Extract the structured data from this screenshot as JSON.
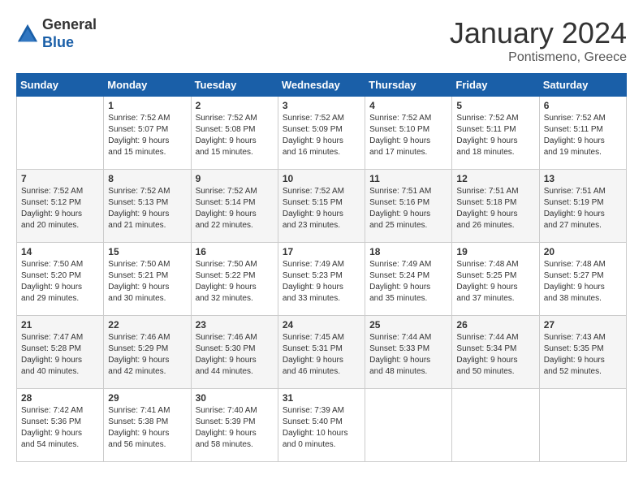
{
  "header": {
    "logo_general": "General",
    "logo_blue": "Blue",
    "month": "January 2024",
    "location": "Pontismeno, Greece"
  },
  "days_of_week": [
    "Sunday",
    "Monday",
    "Tuesday",
    "Wednesday",
    "Thursday",
    "Friday",
    "Saturday"
  ],
  "weeks": [
    [
      {
        "day": "",
        "info": ""
      },
      {
        "day": "1",
        "info": "Sunrise: 7:52 AM\nSunset: 5:07 PM\nDaylight: 9 hours\nand 15 minutes."
      },
      {
        "day": "2",
        "info": "Sunrise: 7:52 AM\nSunset: 5:08 PM\nDaylight: 9 hours\nand 15 minutes."
      },
      {
        "day": "3",
        "info": "Sunrise: 7:52 AM\nSunset: 5:09 PM\nDaylight: 9 hours\nand 16 minutes."
      },
      {
        "day": "4",
        "info": "Sunrise: 7:52 AM\nSunset: 5:10 PM\nDaylight: 9 hours\nand 17 minutes."
      },
      {
        "day": "5",
        "info": "Sunrise: 7:52 AM\nSunset: 5:11 PM\nDaylight: 9 hours\nand 18 minutes."
      },
      {
        "day": "6",
        "info": "Sunrise: 7:52 AM\nSunset: 5:11 PM\nDaylight: 9 hours\nand 19 minutes."
      }
    ],
    [
      {
        "day": "7",
        "info": "Sunrise: 7:52 AM\nSunset: 5:12 PM\nDaylight: 9 hours\nand 20 minutes."
      },
      {
        "day": "8",
        "info": "Sunrise: 7:52 AM\nSunset: 5:13 PM\nDaylight: 9 hours\nand 21 minutes."
      },
      {
        "day": "9",
        "info": "Sunrise: 7:52 AM\nSunset: 5:14 PM\nDaylight: 9 hours\nand 22 minutes."
      },
      {
        "day": "10",
        "info": "Sunrise: 7:52 AM\nSunset: 5:15 PM\nDaylight: 9 hours\nand 23 minutes."
      },
      {
        "day": "11",
        "info": "Sunrise: 7:51 AM\nSunset: 5:16 PM\nDaylight: 9 hours\nand 25 minutes."
      },
      {
        "day": "12",
        "info": "Sunrise: 7:51 AM\nSunset: 5:18 PM\nDaylight: 9 hours\nand 26 minutes."
      },
      {
        "day": "13",
        "info": "Sunrise: 7:51 AM\nSunset: 5:19 PM\nDaylight: 9 hours\nand 27 minutes."
      }
    ],
    [
      {
        "day": "14",
        "info": "Sunrise: 7:50 AM\nSunset: 5:20 PM\nDaylight: 9 hours\nand 29 minutes."
      },
      {
        "day": "15",
        "info": "Sunrise: 7:50 AM\nSunset: 5:21 PM\nDaylight: 9 hours\nand 30 minutes."
      },
      {
        "day": "16",
        "info": "Sunrise: 7:50 AM\nSunset: 5:22 PM\nDaylight: 9 hours\nand 32 minutes."
      },
      {
        "day": "17",
        "info": "Sunrise: 7:49 AM\nSunset: 5:23 PM\nDaylight: 9 hours\nand 33 minutes."
      },
      {
        "day": "18",
        "info": "Sunrise: 7:49 AM\nSunset: 5:24 PM\nDaylight: 9 hours\nand 35 minutes."
      },
      {
        "day": "19",
        "info": "Sunrise: 7:48 AM\nSunset: 5:25 PM\nDaylight: 9 hours\nand 37 minutes."
      },
      {
        "day": "20",
        "info": "Sunrise: 7:48 AM\nSunset: 5:27 PM\nDaylight: 9 hours\nand 38 minutes."
      }
    ],
    [
      {
        "day": "21",
        "info": "Sunrise: 7:47 AM\nSunset: 5:28 PM\nDaylight: 9 hours\nand 40 minutes."
      },
      {
        "day": "22",
        "info": "Sunrise: 7:46 AM\nSunset: 5:29 PM\nDaylight: 9 hours\nand 42 minutes."
      },
      {
        "day": "23",
        "info": "Sunrise: 7:46 AM\nSunset: 5:30 PM\nDaylight: 9 hours\nand 44 minutes."
      },
      {
        "day": "24",
        "info": "Sunrise: 7:45 AM\nSunset: 5:31 PM\nDaylight: 9 hours\nand 46 minutes."
      },
      {
        "day": "25",
        "info": "Sunrise: 7:44 AM\nSunset: 5:33 PM\nDaylight: 9 hours\nand 48 minutes."
      },
      {
        "day": "26",
        "info": "Sunrise: 7:44 AM\nSunset: 5:34 PM\nDaylight: 9 hours\nand 50 minutes."
      },
      {
        "day": "27",
        "info": "Sunrise: 7:43 AM\nSunset: 5:35 PM\nDaylight: 9 hours\nand 52 minutes."
      }
    ],
    [
      {
        "day": "28",
        "info": "Sunrise: 7:42 AM\nSunset: 5:36 PM\nDaylight: 9 hours\nand 54 minutes."
      },
      {
        "day": "29",
        "info": "Sunrise: 7:41 AM\nSunset: 5:38 PM\nDaylight: 9 hours\nand 56 minutes."
      },
      {
        "day": "30",
        "info": "Sunrise: 7:40 AM\nSunset: 5:39 PM\nDaylight: 9 hours\nand 58 minutes."
      },
      {
        "day": "31",
        "info": "Sunrise: 7:39 AM\nSunset: 5:40 PM\nDaylight: 10 hours\nand 0 minutes."
      },
      {
        "day": "",
        "info": ""
      },
      {
        "day": "",
        "info": ""
      },
      {
        "day": "",
        "info": ""
      }
    ]
  ]
}
